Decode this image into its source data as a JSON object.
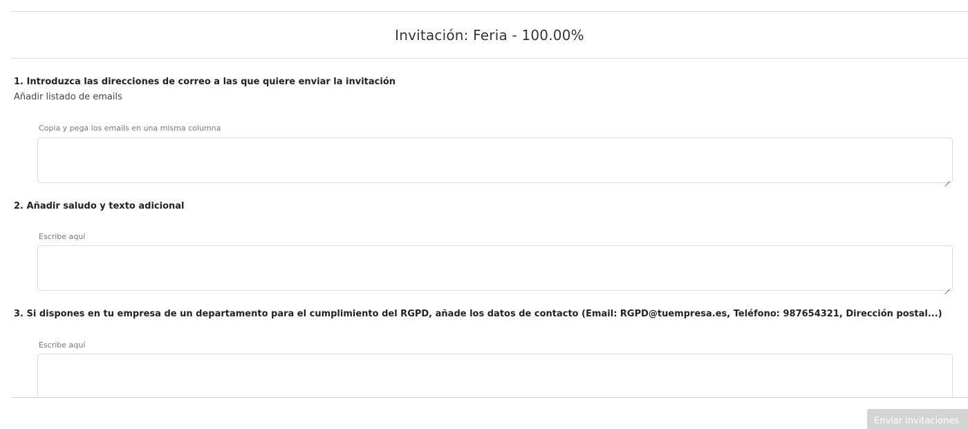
{
  "modal": {
    "title": "Invitación: Feria - 100.00%"
  },
  "steps": [
    {
      "title": "1. Introduzca las direcciones de correo a las que quiere enviar la invitación",
      "sublabel": "Añadir listado de emails",
      "field_label": "Copia y pega los emails en una misma columna",
      "value": ""
    },
    {
      "title": "2. Añadir saludo y texto adicional",
      "field_label": "Escribe aquí",
      "value": ""
    },
    {
      "title": "3. Si dispones en tu empresa de un departamento para el cumplimiento del RGPD, añade los datos de contacto (Email: RGPD@tuempresa.es, Teléfono: 987654321, Dirección postal...)",
      "field_label": "Escribe aquí",
      "value": ""
    }
  ],
  "footer": {
    "send_label": "Enviar invitaciones",
    "send_button_color": "#d4d4d4"
  },
  "icons": {
    "resize_grip": "resize-grip-icon"
  }
}
